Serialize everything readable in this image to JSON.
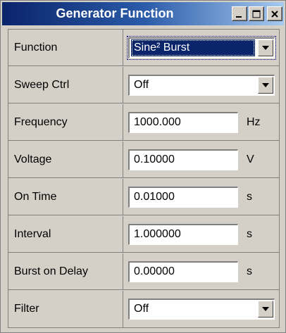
{
  "window": {
    "title": "Generator Function"
  },
  "rows": [
    {
      "label": "Function",
      "value": "Sine² Burst",
      "unit": ""
    },
    {
      "label": "Sweep Ctrl",
      "value": "Off",
      "unit": ""
    },
    {
      "label": "Frequency",
      "value": "1000.000",
      "unit": "Hz"
    },
    {
      "label": "Voltage",
      "value": "0.10000",
      "unit": "V"
    },
    {
      "label": "On Time",
      "value": "0.01000",
      "unit": "s"
    },
    {
      "label": "Interval",
      "value": "1.000000",
      "unit": "s"
    },
    {
      "label": "Burst on Delay",
      "value": "0.00000",
      "unit": "s"
    },
    {
      "label": "Filter",
      "value": "Off",
      "unit": ""
    }
  ],
  "colors": {
    "title_gradient_start": "#0a246a",
    "title_gradient_end": "#a6caf0",
    "selection": "#0a246a",
    "face": "#d4d0c8"
  },
  "icons": [
    "minimize-icon",
    "maximize-icon",
    "close-icon",
    "chevron-down-icon"
  ]
}
